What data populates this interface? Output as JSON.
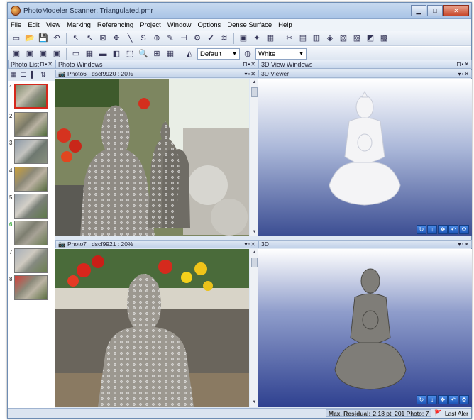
{
  "window": {
    "title": "PhotoModeler Scanner: Triangulated.pmr"
  },
  "menu": [
    "File",
    "Edit",
    "View",
    "Marking",
    "Referencing",
    "Project",
    "Window",
    "Options",
    "Dense Surface",
    "Help"
  ],
  "toolbar2": {
    "default_label": "Default",
    "white_label": "White"
  },
  "panels": {
    "photo_list": "Photo List",
    "photo_windows": "Photo Windows",
    "view3d_windows": "3D View Windows",
    "photo6": "Photo6 : dscf9920 : 20%",
    "photo7": "Photo7 : dscf9921 : 20%",
    "viewer3d": "3D Viewer",
    "view3d": "3D"
  },
  "thumbnails": [
    {
      "num": "1",
      "green": false,
      "selected": true
    },
    {
      "num": "2",
      "green": false,
      "selected": false
    },
    {
      "num": "3",
      "green": false,
      "selected": false
    },
    {
      "num": "4",
      "green": false,
      "selected": false
    },
    {
      "num": "5",
      "green": false,
      "selected": false
    },
    {
      "num": "6",
      "green": true,
      "selected": false
    },
    {
      "num": "7",
      "green": false,
      "selected": false
    },
    {
      "num": "8",
      "green": false,
      "selected": false
    }
  ],
  "status": {
    "residual_label": "Max. Residual:",
    "residual_value": "2.18 pt: 201 Photo: 7",
    "last_alert": "Last Aler"
  },
  "colors": {
    "accent": "#1d56b7",
    "viewer_bg": "#3b4d92"
  }
}
